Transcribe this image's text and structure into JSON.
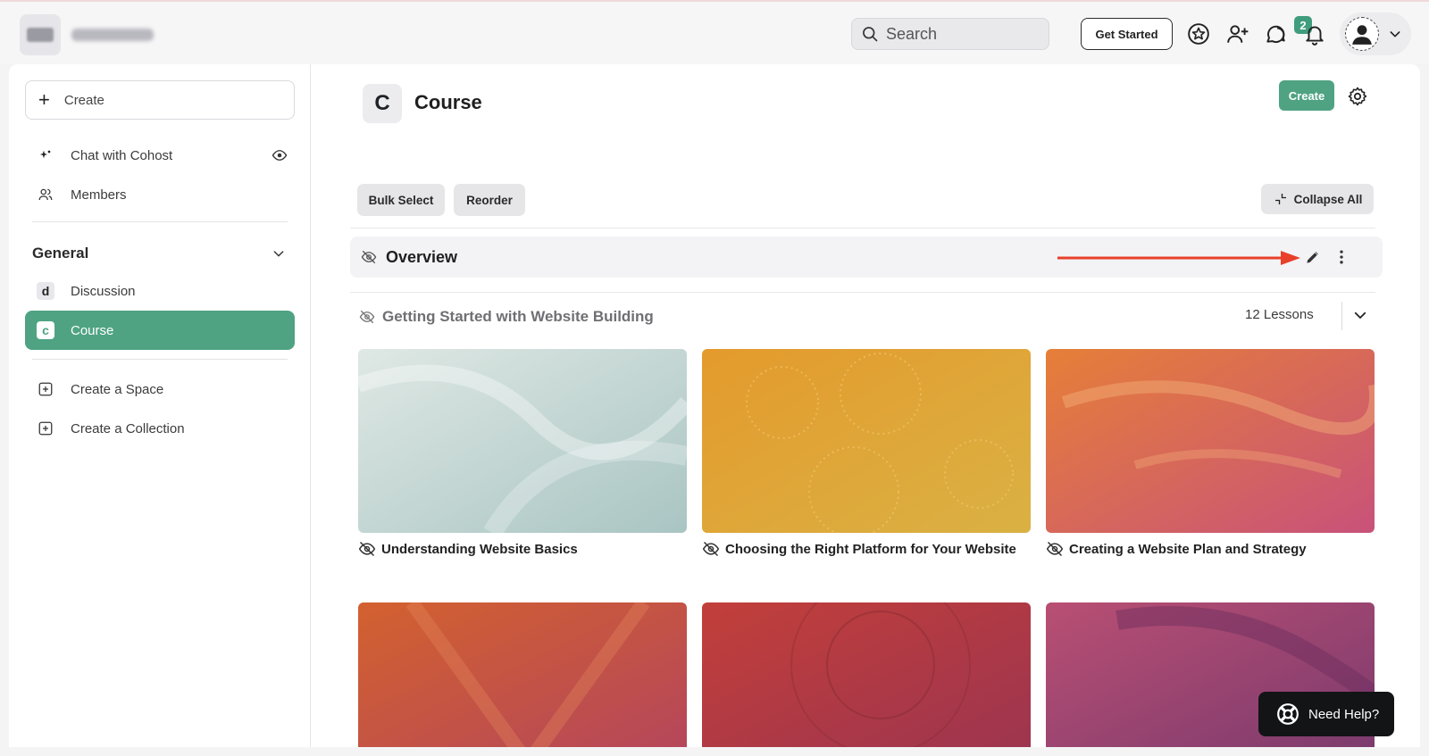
{
  "header": {
    "search_placeholder": "Search",
    "get_started_label": "Get Started",
    "notification_count": "2",
    "icons": [
      "star-badge-icon",
      "add-user-icon",
      "chat-bubbles-icon",
      "bell-icon",
      "user-avatar-icon",
      "chevron-down-icon"
    ]
  },
  "sidebar": {
    "create_label": "Create",
    "items": [
      {
        "label": "Chat with Cohost",
        "icon": "sparkle-icon"
      },
      {
        "label": "Members",
        "icon": "members-icon"
      }
    ],
    "group_title": "General",
    "spaces": [
      {
        "label": "Discussion",
        "letter": "d"
      },
      {
        "label": "Course",
        "letter": "c",
        "active": true
      }
    ],
    "actions": [
      {
        "label": "Create a Space",
        "icon": "plus-square-icon"
      },
      {
        "label": "Create a Collection",
        "icon": "plus-square-icon"
      }
    ]
  },
  "main": {
    "page_letter": "C",
    "page_title": "Course",
    "create_label": "Create",
    "bulk_select_label": "Bulk Select",
    "reorder_label": "Reorder",
    "collapse_all_label": "Collapse All",
    "overview_title": "Overview",
    "section_title": "Getting Started with Website Building",
    "lessons_count": "12 Lessons",
    "lessons": [
      {
        "title": "Understanding Website Basics",
        "colors": [
          "#dfe8e4",
          "#a9c5c3"
        ]
      },
      {
        "title": "Choosing the Right Platform for Your Website",
        "colors": [
          "#e49a2c",
          "#dab144"
        ]
      },
      {
        "title": "Creating a Website Plan and Strategy",
        "colors": [
          "#e67f38",
          "#c8527a"
        ]
      },
      {
        "title": "",
        "colors": [
          "#d3612f",
          "#b4455c"
        ]
      },
      {
        "title": "",
        "colors": [
          "#c23f3a",
          "#9c3450"
        ]
      },
      {
        "title": "",
        "colors": [
          "#b94f73",
          "#7a3a6e"
        ]
      }
    ]
  },
  "help": {
    "label": "Need Help?"
  },
  "colors": {
    "accent": "#4fa383",
    "annotation_arrow": "#e8402a"
  }
}
